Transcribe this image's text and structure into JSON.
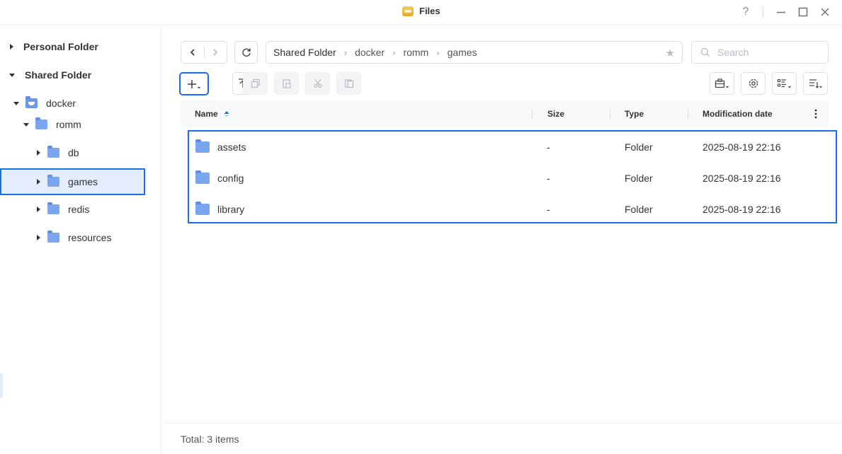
{
  "window": {
    "title": "Files",
    "help_label": "?",
    "colors": {
      "accent": "#1a6ee6",
      "folder": "#7aa6f0",
      "selection": "#e3edfb"
    }
  },
  "sidebar": {
    "personal_folder": "Personal Folder",
    "shared_folder": "Shared Folder",
    "docker": "docker",
    "romm": "romm",
    "children": [
      {
        "label": "db"
      },
      {
        "label": "games"
      },
      {
        "label": "redis"
      },
      {
        "label": "resources"
      }
    ],
    "selected": "games"
  },
  "toolbar": {
    "breadcrumb": [
      "Shared Folder",
      "docker",
      "romm",
      "games"
    ],
    "search_placeholder": "Search",
    "icons": [
      "back-icon",
      "forward-icon",
      "refresh-icon",
      "create-icon",
      "upload-icon",
      "copy-icon",
      "paste-icon",
      "cut-icon",
      "compress-icon",
      "toolbox-icon",
      "settings-icon",
      "view-mode-icon",
      "sort-icon"
    ]
  },
  "table": {
    "headers": {
      "name": "Name",
      "size": "Size",
      "type": "Type",
      "modified": "Modification date"
    },
    "rows": [
      {
        "name": "assets",
        "size": "-",
        "type": "Folder",
        "modified": "2025-08-19 22:16"
      },
      {
        "name": "config",
        "size": "-",
        "type": "Folder",
        "modified": "2025-08-19 22:16"
      },
      {
        "name": "library",
        "size": "-",
        "type": "Folder",
        "modified": "2025-08-19 22:16"
      }
    ]
  },
  "footer": {
    "total": "Total: 3 items"
  }
}
